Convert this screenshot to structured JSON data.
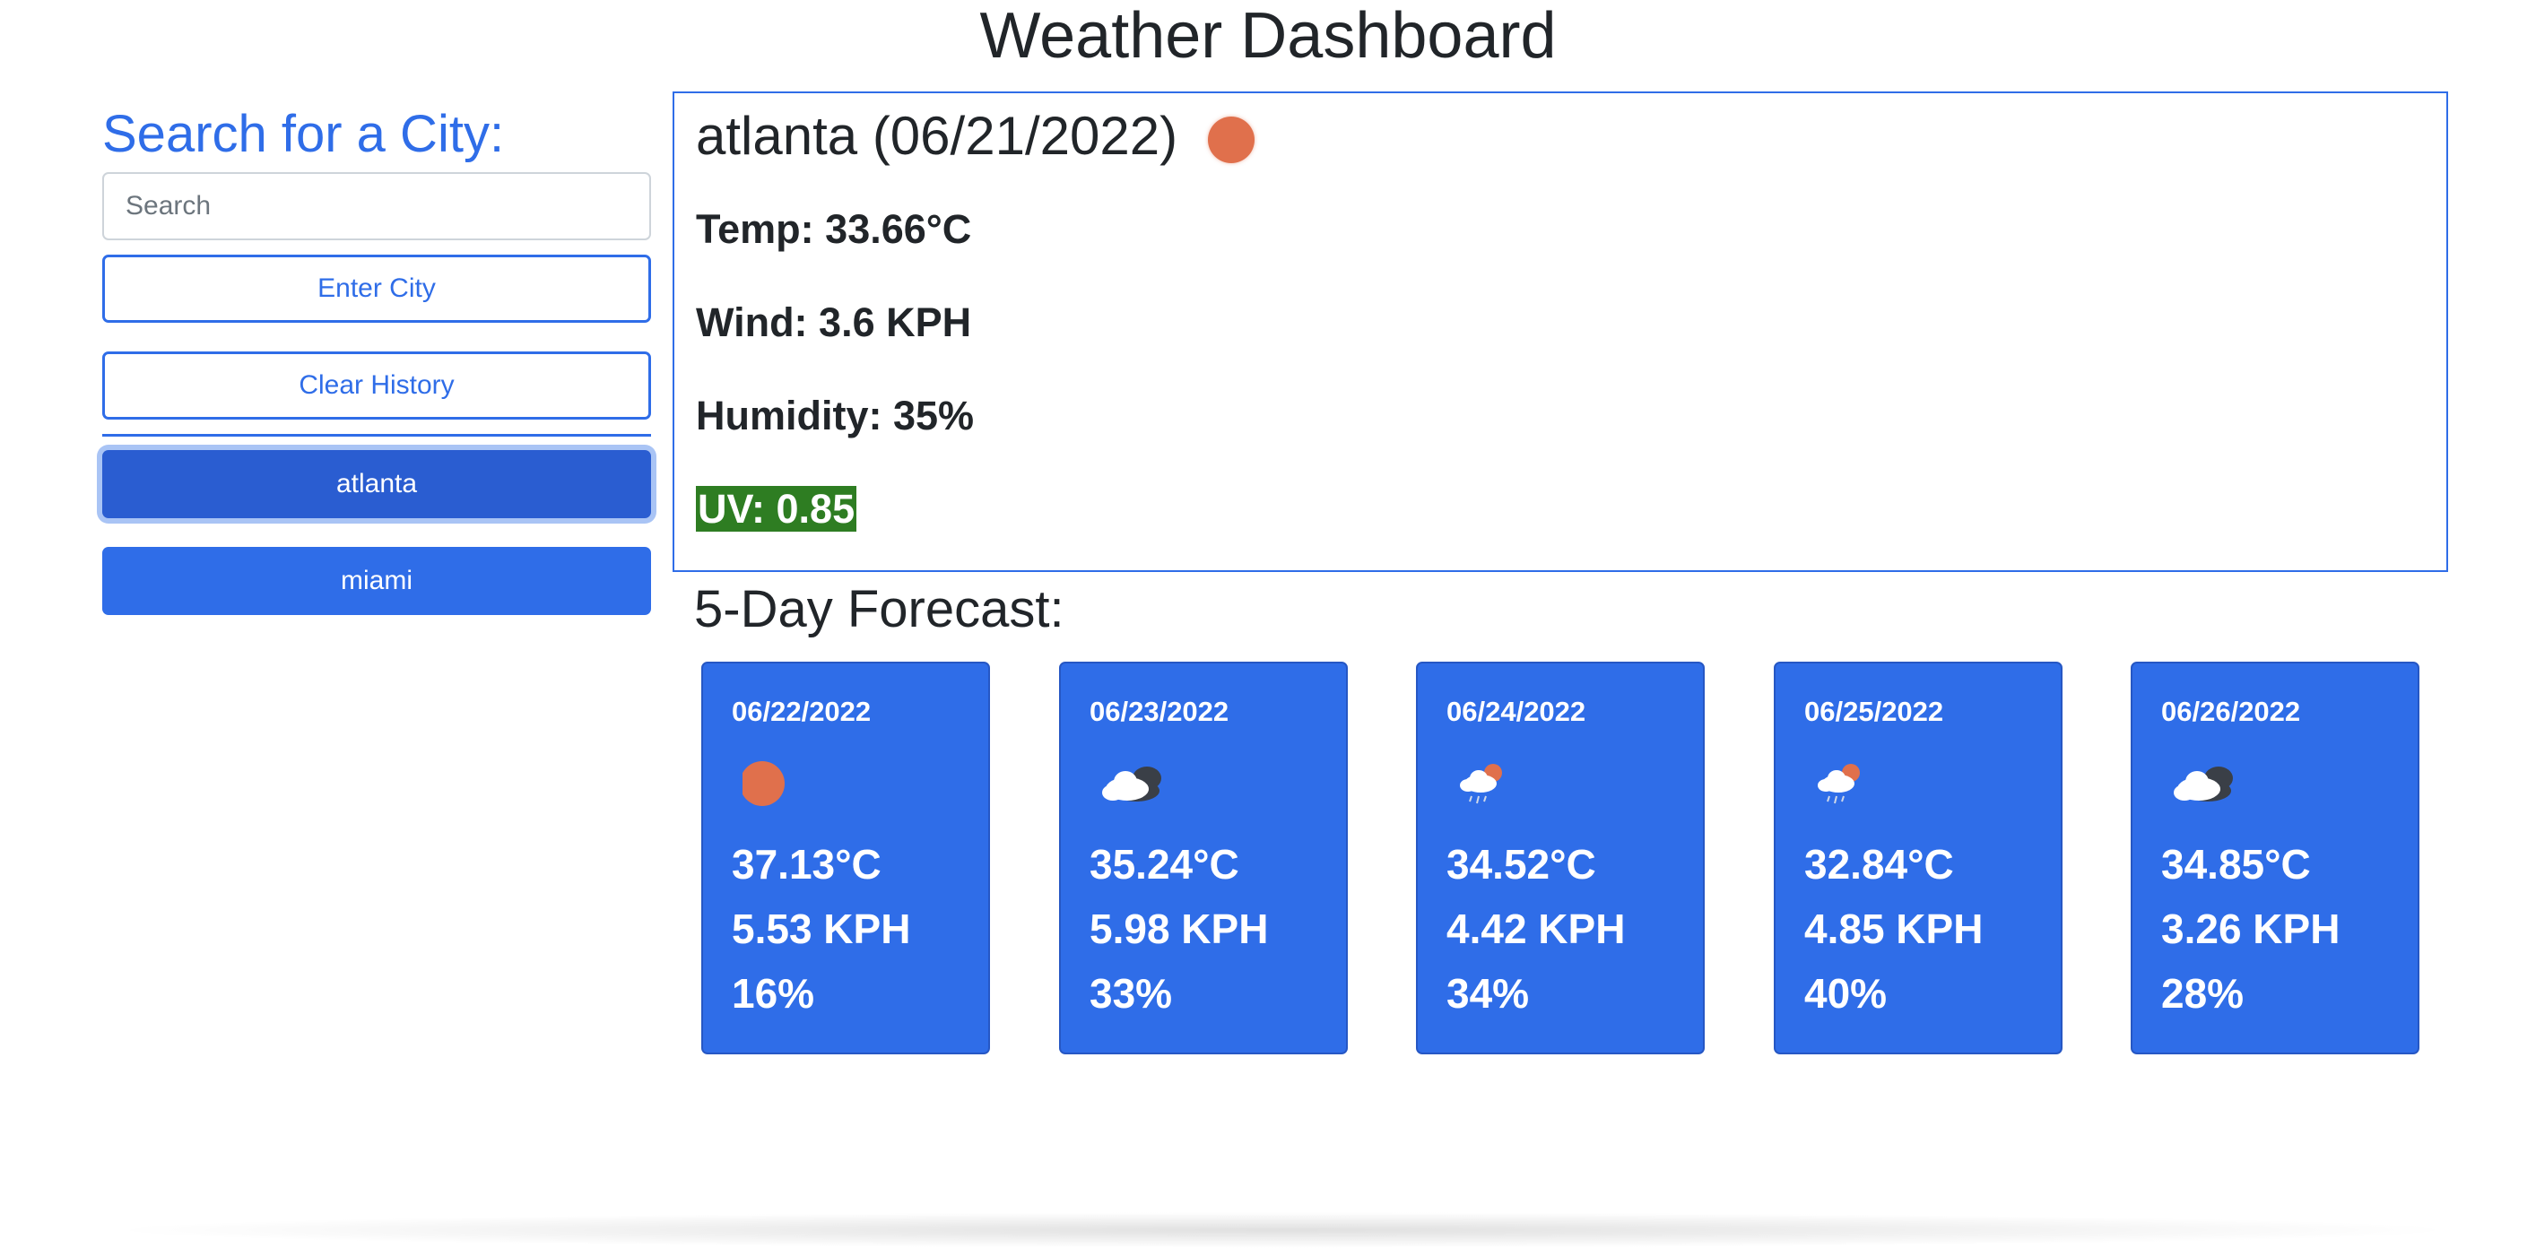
{
  "title": "Weather Dashboard",
  "sidebar": {
    "heading": "Search for a City:",
    "search_placeholder": "Search",
    "search_value": "",
    "enter_label": "Enter City",
    "clear_label": "Clear History",
    "history": [
      {
        "label": "atlanta",
        "active": true
      },
      {
        "label": "miami",
        "active": false
      }
    ]
  },
  "current": {
    "city_date": "atlanta (06/21/2022)",
    "icon": "sun-icon",
    "temp": "Temp: 33.66°C",
    "wind": "Wind: 3.6 KPH",
    "humidity": "Humidity: 35%",
    "uv": "UV: 0.85",
    "uv_color": "#2e7d22"
  },
  "forecast": {
    "heading": "5-Day Forecast:",
    "days": [
      {
        "date": "06/22/2022",
        "icon": "sun-icon",
        "temp": "37.13°C",
        "wind": "5.53 KPH",
        "humidity": "16%"
      },
      {
        "date": "06/23/2022",
        "icon": "cloud-icon",
        "temp": "35.24°C",
        "wind": "5.98 KPH",
        "humidity": "33%"
      },
      {
        "date": "06/24/2022",
        "icon": "rain-sun-icon",
        "temp": "34.52°C",
        "wind": "4.42 KPH",
        "humidity": "34%"
      },
      {
        "date": "06/25/2022",
        "icon": "rain-sun-icon",
        "temp": "32.84°C",
        "wind": "4.85 KPH",
        "humidity": "40%"
      },
      {
        "date": "06/26/2022",
        "icon": "cloud-icon",
        "temp": "34.85°C",
        "wind": "3.26 KPH",
        "humidity": "28%"
      }
    ]
  },
  "colors": {
    "accent": "#2f6de8",
    "sun": "#e0704c",
    "text": "#212529"
  }
}
